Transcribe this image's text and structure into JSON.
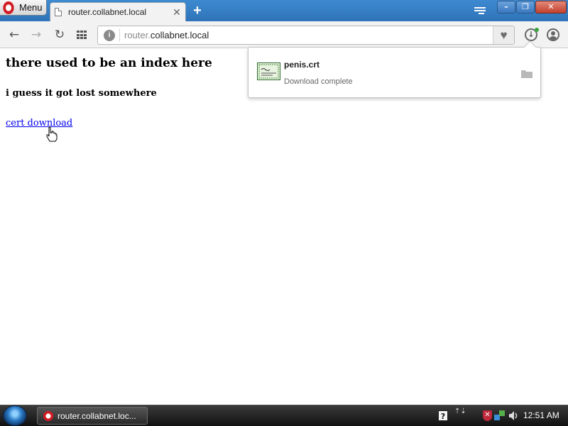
{
  "browser": {
    "menu_label": "Menu",
    "tab": {
      "title": "router.collabnet.local",
      "close_glyph": "✕"
    },
    "new_tab_glyph": "+",
    "window_buttons": {
      "minimize": "–",
      "maximize": "❐",
      "close": "✕"
    }
  },
  "toolbar": {
    "back_glyph": "←",
    "forward_glyph": "→",
    "reload_glyph": "↻",
    "url_sub": "router.",
    "url_domain": "collabnet.local",
    "site_info_glyph": "i",
    "heart_glyph": "♥",
    "download_glyph": "↓"
  },
  "page": {
    "heading": "there used to be an index here",
    "subheading": "i guess it got lost somewhere",
    "link_text": "cert download"
  },
  "download_popup": {
    "file_name": "penis.crt",
    "status": "Download complete"
  },
  "taskbar": {
    "task_title": "router.collabnet.loc...",
    "help_glyph": "?",
    "arrows_glyph": "⇡⇣",
    "shield_glyph": "✕",
    "clock": "12:51 AM"
  },
  "colors": {
    "titlebar": "#3380c6",
    "link": "#0000ee",
    "taskbar": "#1e1e1e"
  },
  "icons": [
    "opera-logo-icon",
    "page-icon",
    "tab-menu-icon",
    "back-icon",
    "forward-icon",
    "reload-icon",
    "speed-dial-icon",
    "site-info-icon",
    "heart-icon",
    "download-icon",
    "profile-icon",
    "certificate-icon",
    "folder-icon",
    "hand-cursor-icon",
    "start-orb-icon",
    "help-icon",
    "shield-icon",
    "network-icon",
    "volume-icon"
  ]
}
